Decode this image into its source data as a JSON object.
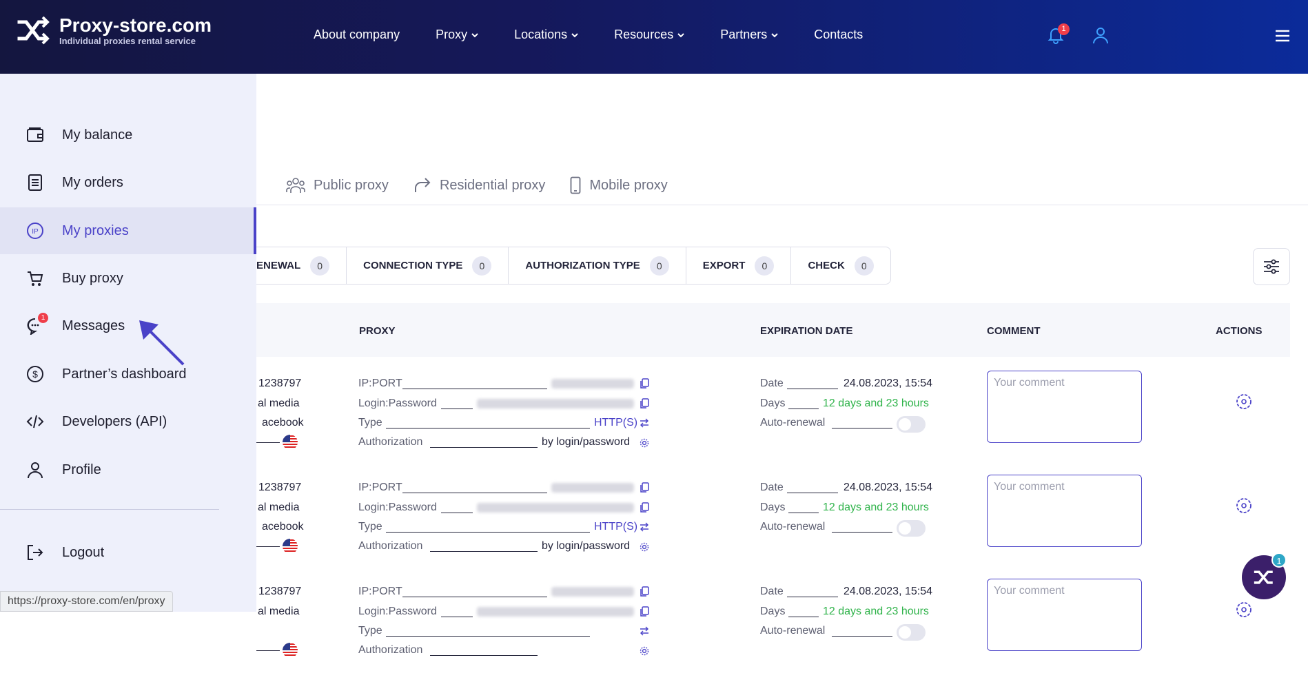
{
  "header": {
    "logo_title": "Proxy-store.com",
    "logo_subtitle": "Individual proxies rental service",
    "nav": [
      {
        "label": "About company"
      },
      {
        "label": "Proxy"
      },
      {
        "label": "Locations"
      },
      {
        "label": "Resources"
      },
      {
        "label": "Partners"
      },
      {
        "label": "Contacts"
      }
    ],
    "notifications_count": "1"
  },
  "sidebar": {
    "items": [
      {
        "label": "My balance",
        "icon": "wallet-icon"
      },
      {
        "label": "My orders",
        "icon": "document-icon"
      },
      {
        "label": "My proxies",
        "icon": "ip-icon",
        "active": true
      },
      {
        "label": "Buy proxy",
        "icon": "cart-icon"
      },
      {
        "label": "Messages",
        "icon": "chat-icon",
        "badge": "1"
      },
      {
        "label": "Partner’s dashboard",
        "icon": "dollar-icon"
      },
      {
        "label": "Developers (API)",
        "icon": "code-icon"
      },
      {
        "label": "Profile",
        "icon": "user-icon"
      }
    ],
    "logout_label": "Logout"
  },
  "tabs": [
    {
      "label": "Public proxy",
      "icon": "users-group-icon"
    },
    {
      "label": "Residential proxy",
      "icon": "share-arrow-icon"
    },
    {
      "label": "Mobile proxy",
      "icon": "phone-icon"
    }
  ],
  "filters": [
    {
      "label": "RENEWAL",
      "count": "0",
      "fragment": "ENEWAL"
    },
    {
      "label": "CONNECTION TYPE",
      "count": "0"
    },
    {
      "label": "AUTHORIZATION TYPE",
      "count": "0"
    },
    {
      "label": "EXPORT",
      "count": "0"
    },
    {
      "label": "CHECK",
      "count": "0"
    }
  ],
  "table": {
    "headers": {
      "proxy": "PROXY",
      "expiration": "EXPIRATION DATE",
      "comment": "COMMENT",
      "actions": "ACTIONS"
    },
    "labels": {
      "ip_port": "IP:PORT",
      "login_password": "Login:Password",
      "type": "Type",
      "authorization": "Authorization",
      "date": "Date",
      "days": "Days",
      "auto_renewal": "Auto-renewal"
    },
    "comment_placeholder": "Your comment",
    "rows": [
      {
        "order_fragment": "1238797",
        "purpose_fragment": "al media",
        "site_fragment": "acebook",
        "type": "HTTP(S)",
        "authorization": "by login/password",
        "date": "24.08.2023, 15:54",
        "days": "12 days and 23 hours"
      },
      {
        "order_fragment": "1238797",
        "purpose_fragment": "al media",
        "site_fragment": "acebook",
        "type": "HTTP(S)",
        "authorization": "by login/password",
        "date": "24.08.2023, 15:54",
        "days": "12 days and 23 hours"
      },
      {
        "order_fragment": "1238797",
        "purpose_fragment": "al media",
        "site_fragment": "",
        "type": "",
        "authorization": "",
        "date": "24.08.2023, 15:54",
        "days": "12 days and 23 hours"
      }
    ]
  },
  "status_url": "https://proxy-store.com/en/proxy",
  "chat_badge": "1",
  "colors": {
    "accent": "#4a42c8",
    "header_start": "#14163f",
    "header_end": "#0b2b9a",
    "green": "#2fb34a",
    "badge_red": "#ef3e4a"
  }
}
